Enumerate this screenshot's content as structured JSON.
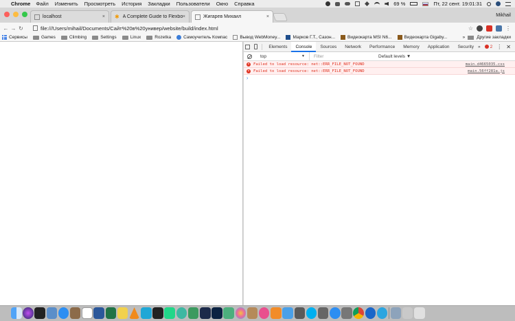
{
  "menubar": {
    "app_name": "Chrome",
    "items": [
      "Файл",
      "Изменить",
      "Просмотреть",
      "История",
      "Закладки",
      "Пользователи",
      "Окно",
      "Справка"
    ],
    "battery": "69 %",
    "datetime": "Пт, 22 сент.  19:01:31"
  },
  "tabs": [
    {
      "title": "localhost",
      "close": "×"
    },
    {
      "title": "A Complete Guide to Flexbox",
      "close": "×"
    },
    {
      "title": "Жигарев Михаил",
      "close": "×"
    }
  ],
  "profile_name": "Mikhail",
  "address": {
    "url": "file:///Users/mihail/Documents/Сайт%20в%20универ/website/build/index.html"
  },
  "bookmarks": {
    "items": [
      "Сервисы",
      "Games",
      "Climbing",
      "Settings",
      "Linux",
      "Rozetka",
      "Самоучитель Компас",
      "Вывод WebMoney...",
      "Марков Г.Т., Сазон...",
      "Видеокарта MSI N6...",
      "Видеокарта Gigaby..."
    ],
    "more": "»",
    "other": "Другие закладки"
  },
  "devtools": {
    "tabs": [
      "Elements",
      "Console",
      "Sources",
      "Network",
      "Performance",
      "Memory",
      "Application",
      "Security"
    ],
    "active_tab": "Console",
    "more_tabs": "»",
    "error_count": "2",
    "context": "top",
    "filter_placeholder": "Filter",
    "levels": "Default levels ▼",
    "messages": [
      {
        "text": "Failed to load resource: net::ERR_FILE_NOT_FOUND",
        "source": "main.d4665035.css"
      },
      {
        "text": "Failed to load resource: net::ERR_FILE_NOT_FOUND",
        "source": "main.56ff281a.js"
      }
    ],
    "prompt": "›"
  },
  "colors": {
    "error_red": "#e0311f",
    "accent_blue": "#1a73e8"
  }
}
